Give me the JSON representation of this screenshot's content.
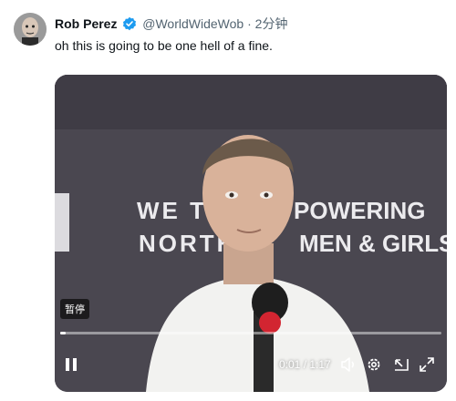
{
  "author": {
    "display_name": "Rob Perez",
    "handle": "@WorldWideWob",
    "separator": "·",
    "time": "2分钟",
    "verified": true
  },
  "tweet": {
    "text": "oh this is going to be one hell of a fine."
  },
  "video": {
    "backdrop_text_left": "WE THE\nNORTH",
    "backdrop_text_right": "POWERING\nMEN & GIRLS",
    "pause_tooltip": "暂停",
    "timecode": "0:01 / 1:17",
    "progress_fraction": 0.015,
    "icons": {
      "play_pause": "pause-icon",
      "volume": "volume-icon",
      "settings": "gear-icon",
      "pip": "picture-in-picture-icon",
      "fullscreen": "fullscreen-icon"
    }
  },
  "colors": {
    "name": "#0f1419",
    "secondary": "#536471",
    "verified_badge": "#1d9bf0",
    "video_backdrop": "#4a4750"
  }
}
